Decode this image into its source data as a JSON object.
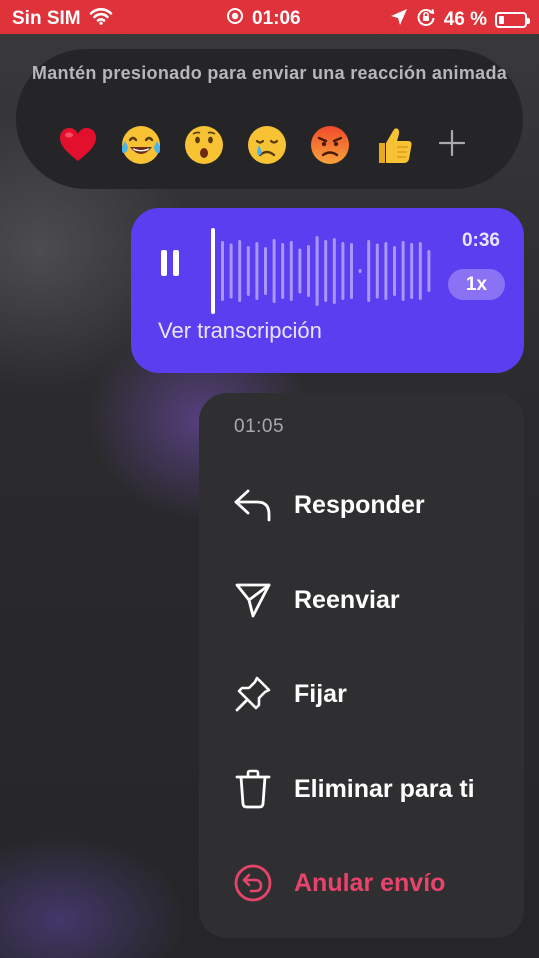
{
  "status_bar": {
    "carrier": "Sin SIM",
    "time": "01:06",
    "battery_percent": "46 %",
    "battery_level": 0.2,
    "icons": [
      "wifi-icon",
      "focus-icon",
      "location-arrow-icon",
      "orientation-lock-icon",
      "battery-icon"
    ]
  },
  "reactions": {
    "hint": "Mantén presionado para enviar una reacción animada",
    "emojis": [
      {
        "name": "heart",
        "glyph": "❤️"
      },
      {
        "name": "tears-of-joy",
        "glyph": "😂"
      },
      {
        "name": "surprised",
        "glyph": "😮"
      },
      {
        "name": "crying",
        "glyph": "😢"
      },
      {
        "name": "angry",
        "glyph": "😡"
      },
      {
        "name": "thumbs-up",
        "glyph": "👍"
      }
    ],
    "more_icon": "plus-icon"
  },
  "voice_message": {
    "duration": "0:36",
    "speed": "1x",
    "transcript_label": "Ver transcripción",
    "state": "playing",
    "progress": 0.0
  },
  "context_menu": {
    "time": "01:05",
    "items": [
      {
        "label": "Responder",
        "icon": "reply-icon"
      },
      {
        "label": "Reenviar",
        "icon": "send-icon"
      },
      {
        "label": "Fijar",
        "icon": "pin-icon"
      },
      {
        "label": "Eliminar para ti",
        "icon": "trash-icon"
      },
      {
        "label": "Anular envío",
        "icon": "unsend-icon",
        "color": "#e8436b"
      }
    ]
  },
  "colors": {
    "status_bar": "#e0323a",
    "bubble": "#5a3ef0",
    "menu_bg": "#2f2f31",
    "danger": "#e8436b"
  }
}
